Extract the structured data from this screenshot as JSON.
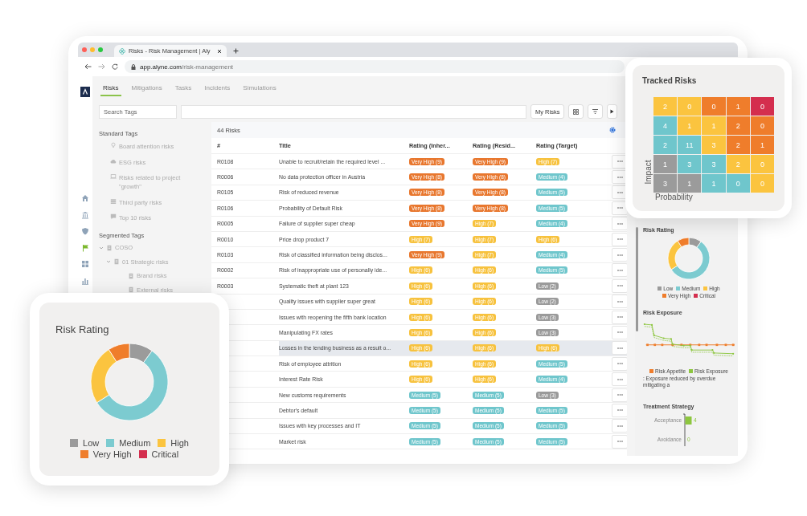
{
  "browser": {
    "tab_title": "Risks - Risk Management | Aly",
    "url": "**app.alyne.com**/risk-management"
  },
  "nav_items": [
    {
      "selected": false
    },
    {
      "selected": false
    },
    {
      "selected": false
    },
    {
      "selected": true
    },
    {
      "selected": false
    },
    {
      "selected": false
    }
  ],
  "tabs": [
    {
      "label": "Risks",
      "selected": true
    },
    {
      "label": "Mitigations",
      "selected": false
    },
    {
      "label": "Tasks",
      "selected": false
    },
    {
      "label": "Incidents",
      "selected": false
    },
    {
      "label": "Simulations",
      "selected": false
    }
  ],
  "toolbar": {
    "search_placeholder": "Search Tags",
    "my_risks": "My Risks"
  },
  "tag_groups": [
    {
      "title": "Standard Tags",
      "items": [
        {
          "label": "Board attention risks"
        },
        {
          "label": "ESG risks"
        },
        {
          "label": "Risks related to project \"growth\""
        },
        {
          "label": "Third party risks"
        },
        {
          "label": "Top 10 risks"
        }
      ]
    },
    {
      "title": "Segmented Tags",
      "items": [
        {
          "label": "COSO",
          "expanded": true,
          "children": [
            {
              "label": "01 Strategic risks",
              "expanded": true,
              "children": [
                {
                  "label": "Brand risks"
                },
                {
                  "label": "External risks"
                }
              ]
            }
          ]
        }
      ]
    }
  ],
  "table": {
    "count": "44 Risks",
    "columns": [
      "#",
      "Title",
      "Rating (Inher...",
      "Rating (Resid...",
      "Rating (Target)"
    ],
    "rows": [
      {
        "id": "R0108",
        "title": "Unable to recruit/retain the required level ...",
        "selected": false,
        "ratings": [
          {
            "text": "Very High (9)",
            "kind": "very-high"
          },
          {
            "text": "Very High (9)",
            "kind": "very-high"
          },
          {
            "text": "High (7)",
            "kind": "high"
          }
        ]
      },
      {
        "id": "R0006",
        "title": "No data protection officer in Austria",
        "selected": false,
        "ratings": [
          {
            "text": "Very High (8)",
            "kind": "very-high"
          },
          {
            "text": "Very High (8)",
            "kind": "very-high"
          },
          {
            "text": "Medium (4)",
            "kind": "medium"
          }
        ]
      },
      {
        "id": "R0105",
        "title": "Risk of reduced revenue",
        "selected": false,
        "ratings": [
          {
            "text": "Very High (8)",
            "kind": "very-high"
          },
          {
            "text": "Very High (8)",
            "kind": "very-high"
          },
          {
            "text": "Medium (5)",
            "kind": "medium"
          }
        ]
      },
      {
        "id": "R0106",
        "title": "Probability of Default Risk",
        "selected": false,
        "ratings": [
          {
            "text": "Very High (8)",
            "kind": "very-high"
          },
          {
            "text": "Very High (8)",
            "kind": "very-high"
          },
          {
            "text": "Medium (5)",
            "kind": "medium"
          }
        ]
      },
      {
        "id": "R0005",
        "title": "Failure of supplier super cheap",
        "selected": false,
        "ratings": [
          {
            "text": "Very High (9)",
            "kind": "very-high"
          },
          {
            "text": "High (7)",
            "kind": "high"
          },
          {
            "text": "Medium (4)",
            "kind": "medium"
          }
        ]
      },
      {
        "id": "R0010",
        "title": "Price drop product 7",
        "selected": false,
        "ratings": [
          {
            "text": "High (7)",
            "kind": "high"
          },
          {
            "text": "High (7)",
            "kind": "high"
          },
          {
            "text": "High (6)",
            "kind": "high"
          }
        ]
      },
      {
        "id": "R0103",
        "title": "Risk of classified information being disclos...",
        "selected": false,
        "ratings": [
          {
            "text": "Very High (9)",
            "kind": "very-high"
          },
          {
            "text": "High (7)",
            "kind": "high"
          },
          {
            "text": "Medium (4)",
            "kind": "medium"
          }
        ]
      },
      {
        "id": "R0002",
        "title": "Risk of inappropriate use of personally ide...",
        "selected": false,
        "ratings": [
          {
            "text": "High (6)",
            "kind": "high"
          },
          {
            "text": "High (6)",
            "kind": "high"
          },
          {
            "text": "Medium (5)",
            "kind": "medium"
          }
        ]
      },
      {
        "id": "R0003",
        "title": "Systematic theft at plant 123",
        "selected": false,
        "ratings": [
          {
            "text": "High (6)",
            "kind": "high"
          },
          {
            "text": "High (6)",
            "kind": "high"
          },
          {
            "text": "Low (2)",
            "kind": "low"
          }
        ]
      },
      {
        "title": "Quality issues with supplier super great",
        "selected": false,
        "ratings": [
          {
            "text": "High (6)",
            "kind": "high"
          },
          {
            "text": "High (6)",
            "kind": "high"
          },
          {
            "text": "Low (2)",
            "kind": "low"
          }
        ]
      },
      {
        "title": "Issues with reopening the fifth bank location",
        "selected": false,
        "ratings": [
          {
            "text": "High (6)",
            "kind": "high"
          },
          {
            "text": "High (6)",
            "kind": "high"
          },
          {
            "text": "Low (3)",
            "kind": "low"
          }
        ]
      },
      {
        "title": "Manipulating FX rates",
        "selected": false,
        "ratings": [
          {
            "text": "High (6)",
            "kind": "high"
          },
          {
            "text": "High (6)",
            "kind": "high"
          },
          {
            "text": "Low (3)",
            "kind": "low"
          }
        ]
      },
      {
        "title": "Losses in the lending business as a result o...",
        "selected": true,
        "ratings": [
          {
            "text": "High (6)",
            "kind": "high"
          },
          {
            "text": "High (6)",
            "kind": "high"
          },
          {
            "text": "High (6)",
            "kind": "high"
          }
        ]
      },
      {
        "title": "Risk of employee attrition",
        "selected": false,
        "ratings": [
          {
            "text": "High (6)",
            "kind": "high"
          },
          {
            "text": "High (6)",
            "kind": "high"
          },
          {
            "text": "Medium (5)",
            "kind": "medium"
          }
        ]
      },
      {
        "title": "Interest Rate Risk",
        "selected": false,
        "ratings": [
          {
            "text": "High (6)",
            "kind": "high"
          },
          {
            "text": "High (6)",
            "kind": "high"
          },
          {
            "text": "Medium (4)",
            "kind": "medium"
          }
        ]
      },
      {
        "title": "New customs requirements",
        "selected": false,
        "ratings": [
          {
            "text": "Medium (5)",
            "kind": "medium"
          },
          {
            "text": "Medium (5)",
            "kind": "medium"
          },
          {
            "text": "Low (3)",
            "kind": "low"
          }
        ]
      },
      {
        "title": "Debtor's default",
        "selected": false,
        "ratings": [
          {
            "text": "Medium (5)",
            "kind": "medium"
          },
          {
            "text": "Medium (5)",
            "kind": "medium"
          },
          {
            "text": "Medium (5)",
            "kind": "medium"
          }
        ]
      },
      {
        "title": "Issues with key processes and IT",
        "selected": false,
        "ratings": [
          {
            "text": "Medium (5)",
            "kind": "medium"
          },
          {
            "text": "Medium (5)",
            "kind": "medium"
          },
          {
            "text": "Medium (5)",
            "kind": "medium"
          }
        ]
      },
      {
        "title": "Market risk",
        "selected": false,
        "ratings": [
          {
            "text": "Medium (5)",
            "kind": "medium"
          },
          {
            "text": "Medium (5)",
            "kind": "medium"
          },
          {
            "text": "Medium (5)",
            "kind": "medium"
          }
        ]
      }
    ]
  },
  "right_panel": {
    "risk_rating": {
      "title": "Risk Rating",
      "legend": [
        {
          "label": "Low",
          "color": "#9b9b9b"
        },
        {
          "label": "Medium",
          "color": "#7ccbd0"
        },
        {
          "label": "High",
          "color": "#fbc43f"
        },
        {
          "label": "Very High",
          "color": "#ef7d2b"
        },
        {
          "label": "Critical",
          "color": "#d42e4e"
        }
      ]
    },
    "risk_exposure": {
      "title": "Risk Exposure",
      "legend": [
        {
          "label": "Risk Appetite",
          "color": "#ef7d2b"
        },
        {
          "label": "Risk Exposure",
          "color": "#8dc63f"
        }
      ],
      "note": ": Exposure reduced by overdue mitigating a"
    },
    "treatment_strategy": {
      "title": "Treatment Strategy",
      "chart_data": {
        "type": "bar",
        "orientation": "horizontal",
        "categories": [
          "Acceptance",
          "Avoidance"
        ],
        "values": [
          4,
          0
        ],
        "data_labels": true
      }
    }
  },
  "tracked_risks": {
    "title": "Tracked Risks",
    "ylabel": "Impact",
    "xlabel": "Probability",
    "rows": [
      {
        "cells": [
          {
            "value": "2",
            "color": "#fbc43f"
          },
          {
            "value": "0",
            "color": "#fbc43f"
          },
          {
            "value": "0",
            "color": "#ef7d2b"
          },
          {
            "value": "1",
            "color": "#ef7d2b"
          },
          {
            "value": "0",
            "color": "#d42e4e"
          }
        ]
      },
      {
        "cells": [
          {
            "value": "4",
            "color": "#6fc6cc"
          },
          {
            "value": "1",
            "color": "#fbc43f"
          },
          {
            "value": "1",
            "color": "#fbc43f"
          },
          {
            "value": "2",
            "color": "#ef7d2b"
          },
          {
            "value": "0",
            "color": "#ef7d2b"
          }
        ]
      },
      {
        "cells": [
          {
            "value": "2",
            "color": "#6fc6cc"
          },
          {
            "value": "11",
            "color": "#6fc6cc"
          },
          {
            "value": "3",
            "color": "#fbc43f"
          },
          {
            "value": "2",
            "color": "#ef7d2b"
          },
          {
            "value": "1",
            "color": "#ef7d2b"
          }
        ]
      },
      {
        "cells": [
          {
            "value": "1",
            "color": "#9b9b9b"
          },
          {
            "value": "3",
            "color": "#6fc6cc"
          },
          {
            "value": "3",
            "color": "#6fc6cc"
          },
          {
            "value": "2",
            "color": "#fbc43f"
          },
          {
            "value": "0",
            "color": "#fbc43f"
          }
        ]
      },
      {
        "cells": [
          {
            "value": "3",
            "color": "#9b9b9b"
          },
          {
            "value": "1",
            "color": "#9b9b9b"
          },
          {
            "value": "1",
            "color": "#6fc6cc"
          },
          {
            "value": "0",
            "color": "#6fc6cc"
          },
          {
            "value": "0",
            "color": "#fbc43f"
          }
        ]
      }
    ]
  },
  "risk_rating_card": {
    "title": "Risk Rating",
    "legend": [
      {
        "label": "Low",
        "color": "#9b9b9b"
      },
      {
        "label": "Medium",
        "color": "#7ccbd0"
      },
      {
        "label": "High",
        "color": "#fbc43f"
      },
      {
        "label": "Very High",
        "color": "#ef7d2b"
      },
      {
        "label": "Critical",
        "color": "#d42e4e"
      }
    ]
  }
}
